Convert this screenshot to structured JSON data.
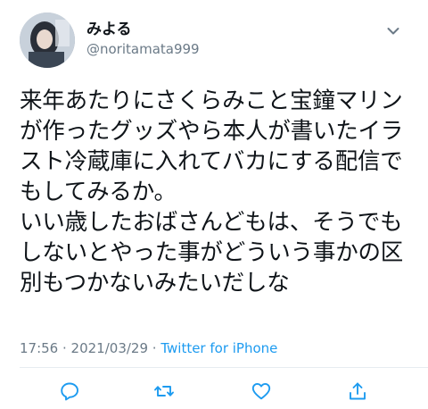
{
  "user": {
    "display_name": "みよる",
    "handle": "@noritamata999"
  },
  "tweet": {
    "lines": [
      "来年あたりにさくらみこと宝鐘マリン",
      "が作ったグッズやら本人が書いたイラ",
      "スト冷蔵庫に入れてバカにする配信で",
      "もしてみるか。",
      "いい歳したおばさんどもは、そうでも",
      "しないとやった事がどういう事かの区",
      "別もつかないみたいだしな"
    ]
  },
  "meta": {
    "time": "17:56",
    "separator": " · ",
    "date": "2021/03/29",
    "source": "Twitter for iPhone"
  },
  "icons": {
    "more": "chevron-down-icon",
    "reply": "reply-icon",
    "retweet": "retweet-icon",
    "like": "like-icon",
    "share": "share-icon"
  },
  "colors": {
    "text": "#0f1419",
    "secondary": "#6b7a87",
    "link": "#1d9bf0",
    "divider": "#e6ecf0",
    "icon": "#1d9bf0"
  }
}
